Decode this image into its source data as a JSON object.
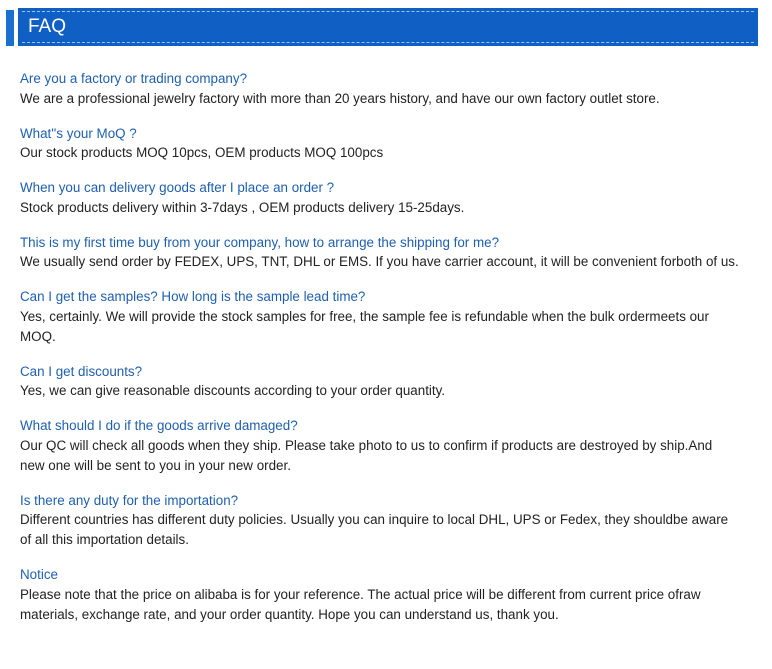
{
  "header": {
    "title": "FAQ",
    "accent_color": "#1a6fd1",
    "background_color": "#0f5fc4"
  },
  "faq": [
    {
      "question": "Are you a factory or trading company?",
      "answer": "We are a professional jewelry factory with more than 20 years history, and have our own factory outlet store."
    },
    {
      "question": "What''s your MoQ ?",
      "answer": "Our stock products MOQ 10pcs, OEM products MOQ 100pcs"
    },
    {
      "question": "When you can delivery goods after I place an order ?",
      "answer": "Stock products delivery within 3-7days , OEM products delivery 15-25days."
    },
    {
      "question": "This is my first time buy from your company, how to arrange the shipping for me?",
      "answer": "We usually send order by FEDEX, UPS, TNT, DHL or EMS. If you have carrier account, it will be convenient forboth of us."
    },
    {
      "question": "Can I get the samples? How long is the sample lead time?",
      "answer": "Yes, certainly. We will provide the stock samples for free, the sample fee is refundable when the bulk ordermeets our MOQ."
    },
    {
      "question": "Can I get discounts?",
      "answer": "Yes, we can give reasonable discounts according to your order quantity."
    },
    {
      "question": "What should I do if the goods arrive damaged?",
      "answer": "Our QC will check all goods when they ship. Please take photo to us to confirm if products are destroyed by ship.And new one will be sent to you in your new order."
    },
    {
      "question": "Is there any duty for the importation?",
      "answer": "Different countries has different duty policies. Usually you can inquire to local DHL, UPS or Fedex, they shouldbe aware of all this importation details."
    },
    {
      "question": "Notice",
      "answer": "Please note that the price on alibaba is for your reference. The actual price will be different from current price ofraw materials, exchange rate, and your order quantity. Hope you can understand us, thank you."
    }
  ]
}
